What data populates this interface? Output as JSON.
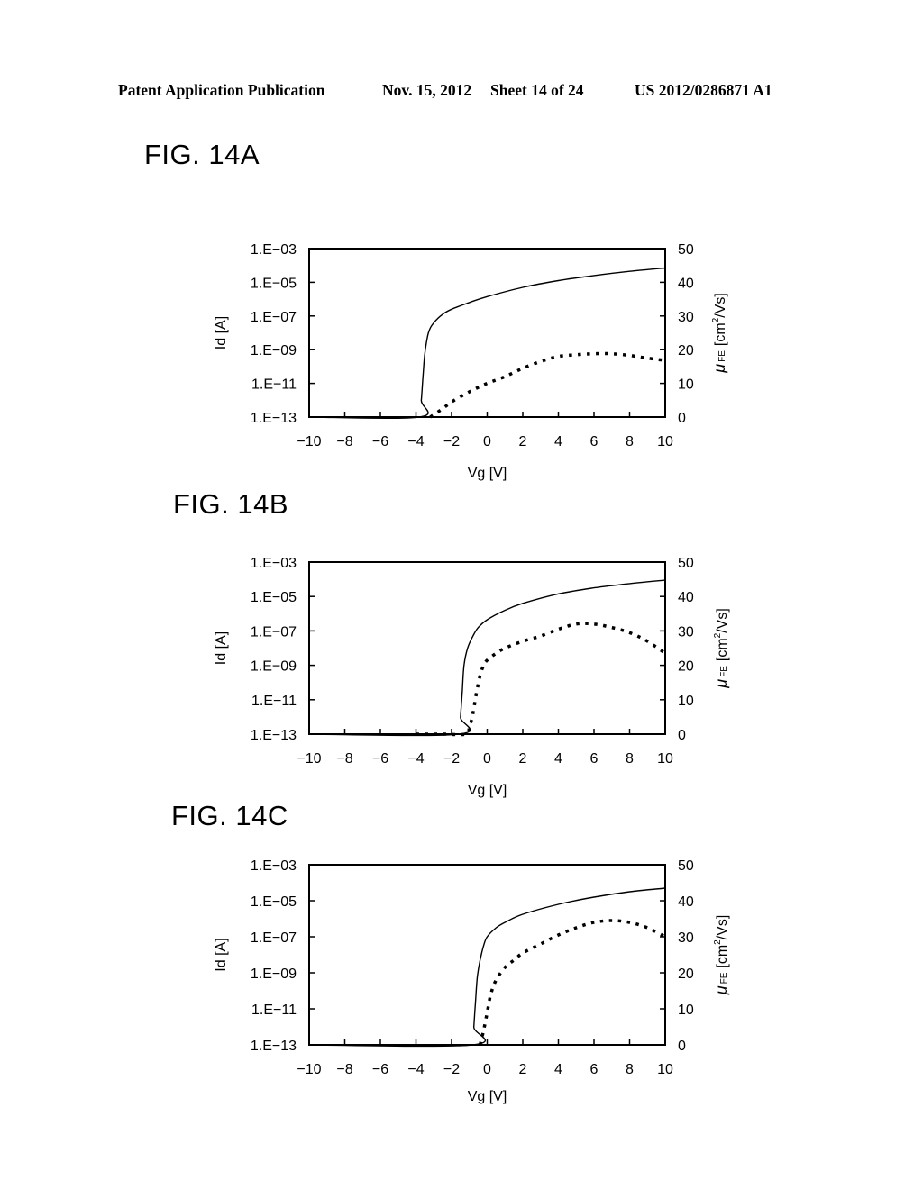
{
  "header": {
    "publication": "Patent Application Publication",
    "date": "Nov. 15, 2012",
    "sheet": "Sheet 14 of 24",
    "number": "US 2012/0286871 A1"
  },
  "chart_data": [
    {
      "id": "14A",
      "title": "FIG. 14A",
      "type": "line",
      "xlabel": "Vg [V]",
      "ylabel_left": "Id [A]",
      "ylabel_right_main": "μ",
      "ylabel_right_sub": "FE",
      "ylabel_right_unit": "[cm",
      "ylabel_right_sup": "2",
      "ylabel_right_tail": "/Vs]",
      "xlim": [
        -10,
        10
      ],
      "ylim_left_log10": [
        -13,
        -3
      ],
      "ylim_right": [
        0,
        50
      ],
      "x_ticks": [
        "−10",
        "−8",
        "−6",
        "−4",
        "−2",
        "0",
        "2",
        "4",
        "6",
        "8",
        "10"
      ],
      "y_left_ticks": [
        "1.E−03",
        "1.E−05",
        "1.E−07",
        "1.E−09",
        "1.E−11",
        "1.E−13"
      ],
      "y_right_ticks": [
        "50",
        "40",
        "30",
        "20",
        "10",
        "0"
      ],
      "grid": false,
      "series": [
        {
          "name": "Id",
          "axis": "left",
          "style": "solid",
          "x": [
            -10,
            -3.8,
            -3.7,
            -3.6,
            -3.5,
            -3.3,
            -3.0,
            -2.5,
            -2.0,
            -1.0,
            0,
            2,
            4,
            6,
            8,
            10
          ],
          "log10_y": [
            -13,
            -13,
            -12,
            -10.5,
            -9.2,
            -8.0,
            -7.4,
            -6.9,
            -6.6,
            -6.2,
            -5.85,
            -5.3,
            -4.9,
            -4.6,
            -4.35,
            -4.15
          ]
        },
        {
          "name": "μFE",
          "axis": "right",
          "style": "dotted",
          "x": [
            -3.2,
            -2.5,
            -2.0,
            -1.0,
            0,
            1,
            2,
            3,
            4,
            5,
            6,
            7,
            8,
            9,
            10
          ],
          "y": [
            0,
            2.5,
            4.5,
            7.5,
            10,
            12,
            14.5,
            16.5,
            18,
            18.5,
            18.8,
            18.8,
            18.3,
            17.5,
            16.8
          ]
        }
      ]
    },
    {
      "id": "14B",
      "title": "FIG. 14B",
      "type": "line",
      "xlabel": "Vg [V]",
      "ylabel_left": "Id [A]",
      "ylabel_right_main": "μ",
      "ylabel_right_sub": "FE",
      "ylabel_right_unit": "[cm",
      "ylabel_right_sup": "2",
      "ylabel_right_tail": "/Vs]",
      "xlim": [
        -10,
        10
      ],
      "ylim_left_log10": [
        -13,
        -3
      ],
      "ylim_right": [
        0,
        50
      ],
      "x_ticks": [
        "−10",
        "−8",
        "−6",
        "−4",
        "−2",
        "0",
        "2",
        "4",
        "6",
        "8",
        "10"
      ],
      "y_left_ticks": [
        "1.E−03",
        "1.E−05",
        "1.E−07",
        "1.E−09",
        "1.E−11",
        "1.E−13"
      ],
      "y_right_ticks": [
        "50",
        "40",
        "30",
        "20",
        "10",
        "0"
      ],
      "grid": false,
      "series": [
        {
          "name": "Id",
          "axis": "left",
          "style": "solid",
          "x": [
            -10,
            -1.6,
            -1.5,
            -1.4,
            -1.3,
            -1.1,
            -0.8,
            -0.5,
            0,
            1,
            2,
            4,
            6,
            8,
            10
          ],
          "log10_y": [
            -13,
            -13,
            -12,
            -10.5,
            -9.0,
            -8.0,
            -7.3,
            -6.8,
            -6.35,
            -5.8,
            -5.4,
            -4.85,
            -4.5,
            -4.25,
            -4.05
          ]
        },
        {
          "name": "μFE",
          "axis": "right",
          "style": "dotted",
          "x": [
            -4.0,
            -2.5,
            -1.2,
            -1.0,
            -0.8,
            -0.6,
            -0.4,
            -0.2,
            0,
            0.5,
            1,
            2,
            3,
            4,
            5,
            6,
            7,
            8,
            9,
            10
          ],
          "y": [
            0,
            0,
            0,
            2,
            6,
            12,
            17,
            20,
            21.5,
            23.5,
            25,
            27,
            28.5,
            30.5,
            32,
            32,
            31,
            29.5,
            27,
            23.5
          ]
        }
      ]
    },
    {
      "id": "14C",
      "title": "FIG. 14C",
      "type": "line",
      "xlabel": "Vg [V]",
      "ylabel_left": "Id [A]",
      "ylabel_right_main": "μ",
      "ylabel_right_sub": "FE",
      "ylabel_right_unit": "[cm",
      "ylabel_right_sup": "2",
      "ylabel_right_tail": "/Vs]",
      "xlim": [
        -10,
        10
      ],
      "ylim_left_log10": [
        -13,
        -3
      ],
      "ylim_right": [
        0,
        50
      ],
      "x_ticks": [
        "−10",
        "−8",
        "−6",
        "−4",
        "−2",
        "0",
        "2",
        "4",
        "6",
        "8",
        "10"
      ],
      "y_left_ticks": [
        "1.E−03",
        "1.E−05",
        "1.E−07",
        "1.E−09",
        "1.E−11",
        "1.E−13"
      ],
      "y_right_ticks": [
        "50",
        "40",
        "30",
        "20",
        "10",
        "0"
      ],
      "grid": false,
      "series": [
        {
          "name": "Id",
          "axis": "left",
          "style": "solid",
          "x": [
            -10,
            -0.8,
            -0.75,
            -0.65,
            -0.55,
            -0.4,
            -0.2,
            0,
            0.5,
            1,
            2,
            4,
            6,
            8,
            10
          ],
          "log10_y": [
            -13,
            -13,
            -12,
            -10.5,
            -9.2,
            -8.3,
            -7.5,
            -7.0,
            -6.5,
            -6.2,
            -5.75,
            -5.2,
            -4.8,
            -4.5,
            -4.3
          ]
        },
        {
          "name": "μFE",
          "axis": "right",
          "style": "dotted",
          "x": [
            -0.4,
            -0.2,
            0,
            0.2,
            0.5,
            1,
            1.5,
            2,
            3,
            4,
            5,
            6,
            7,
            8,
            9,
            10
          ],
          "y": [
            0,
            4,
            9,
            14,
            18,
            21.5,
            23.5,
            25.5,
            28,
            30.5,
            32.5,
            34,
            34.5,
            34,
            32.5,
            30
          ]
        }
      ]
    }
  ]
}
